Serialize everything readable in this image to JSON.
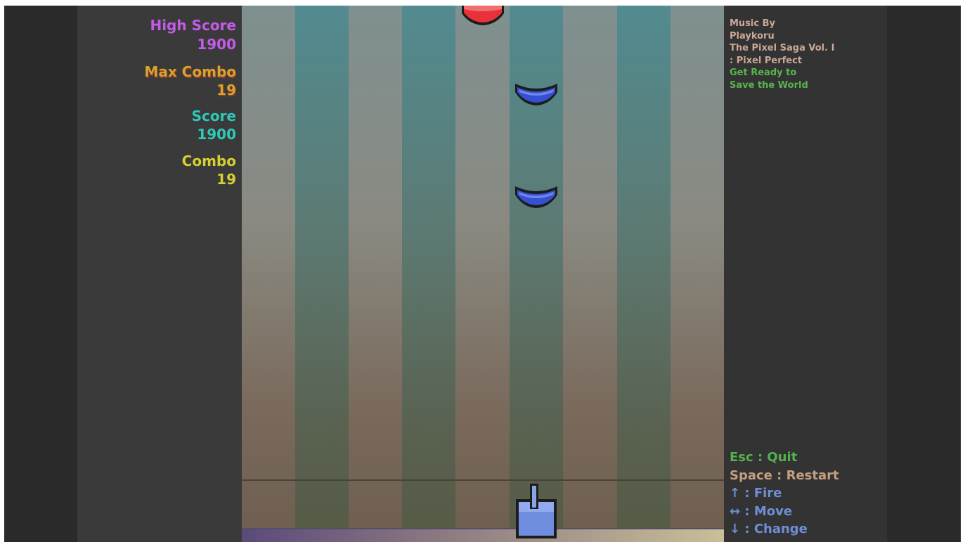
{
  "stats": {
    "high_score_label": "High Score",
    "high_score_value": "1900",
    "max_combo_label": "Max Combo",
    "max_combo_value": "19",
    "score_label": "Score",
    "score_value": "1900",
    "combo_label": "Combo",
    "combo_value": "19"
  },
  "credits": {
    "line1": "Music By",
    "line2": "Playkoru",
    "line3": "The Pixel Saga Vol. I",
    "line4": ": Pixel Perfect",
    "line5": "Get Ready to",
    "line6": "Save the World"
  },
  "controls": {
    "quit": "Esc : Quit",
    "restart": "Space : Restart",
    "fire": "↑ : Fire",
    "move": "↔ : Move",
    "change": "↓ : Change"
  },
  "colors": {
    "high_score": "#c35be8",
    "max_combo": "#d9a22c",
    "score": "#2fc9b9",
    "combo": "#d6cf30",
    "note_red": "#e8323a",
    "note_blue": "#3550d0",
    "player": "#6f8ee0"
  },
  "icons": [
    "note-red-icon",
    "note-blue-icon",
    "player-cannon-icon"
  ]
}
